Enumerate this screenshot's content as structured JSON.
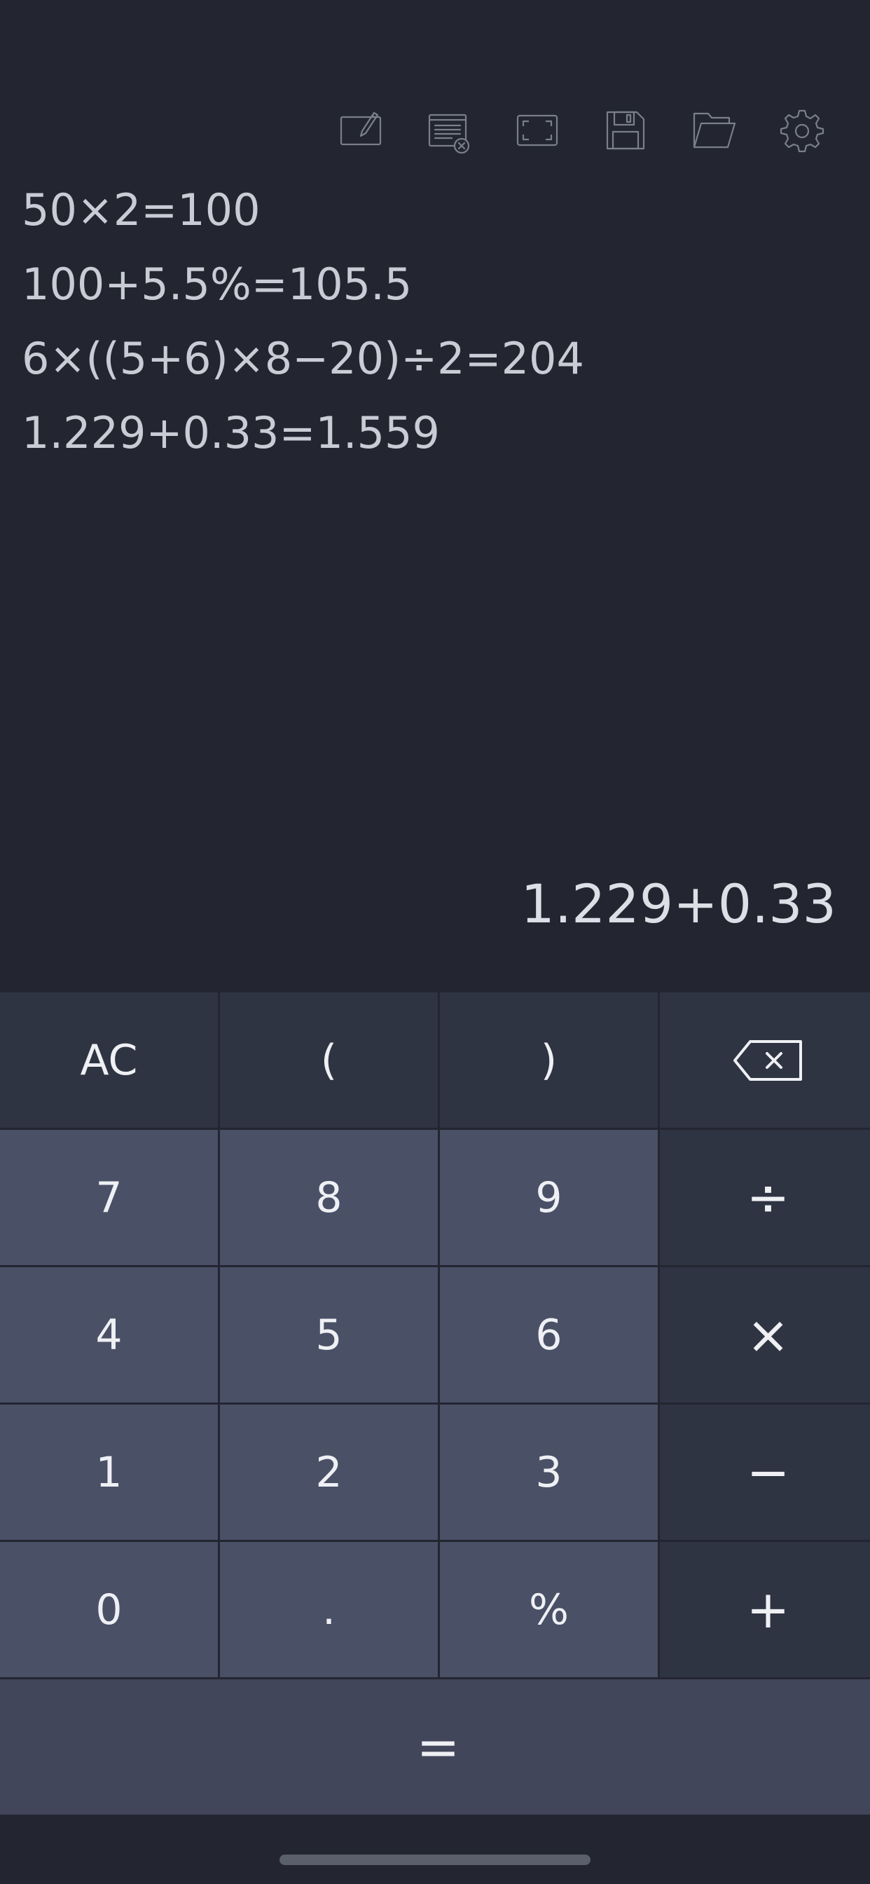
{
  "toolbar": {
    "icons": [
      "edit-icon",
      "clear-history-icon",
      "fullscreen-icon",
      "save-icon",
      "folder-icon",
      "settings-icon"
    ]
  },
  "history": [
    "50×2=100",
    "100+5.5%=105.5",
    "6×((5+6)×8−20)÷2=204",
    "1.229+0.33=1.559"
  ],
  "display": {
    "expression": "1.229+0.33"
  },
  "keypad": {
    "ac": "AC",
    "open_paren": "(",
    "close_paren": ")",
    "backspace_icon": "backspace-icon",
    "seven": "7",
    "eight": "8",
    "nine": "9",
    "divide": "÷",
    "four": "4",
    "five": "5",
    "six": "6",
    "multiply": "×",
    "one": "1",
    "two": "2",
    "three": "3",
    "minus": "−",
    "zero": "0",
    "decimal": ".",
    "percent": "%",
    "plus": "+",
    "equals": "="
  },
  "colors": {
    "background": "#232631",
    "function_key": "#2f3443",
    "number_key": "#4a5066",
    "equals_key": "#41465a",
    "text": "#eef0f4",
    "toolbar_icon": "#7b7f8c"
  }
}
